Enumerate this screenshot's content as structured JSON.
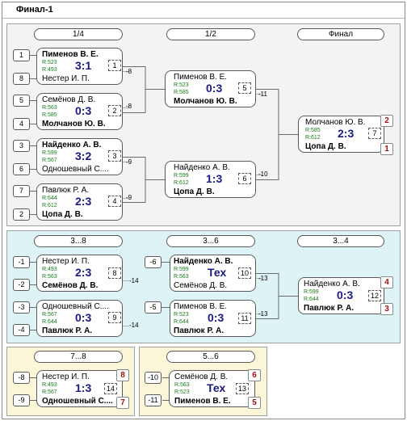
{
  "title": "Финал-1",
  "colors": {
    "score": "#1a1a80",
    "rating": "#1a7a1a",
    "place": "#a01010",
    "main_bg": "#f3f3f3",
    "consolation_bg": "#def3f6",
    "lower_bg": "#fbf6d8"
  },
  "rounds": {
    "quarter": "1/4",
    "semi": "1/2",
    "final": "Финал",
    "r3_8": "3...8",
    "r3_6": "3...6",
    "r3_4": "3...4",
    "r7_8": "7...8",
    "r5_6": "5...6"
  },
  "main": {
    "seeds": [
      "1",
      "8",
      "5",
      "4",
      "3",
      "6",
      "7",
      "2"
    ],
    "qf": [
      {
        "p1": "Пименов В. Е.",
        "r1": "R:523",
        "p2": "Нестер И. П.",
        "r2": "R:493",
        "score": "3:1",
        "num": "1",
        "loser": "-8"
      },
      {
        "p1": "Семёнов Д. В.",
        "r1": "R:563",
        "p2": "Молчанов Ю. В.",
        "r2": "R:585",
        "score": "0:3",
        "num": "2",
        "loser": "-8"
      },
      {
        "p1": "Найденко А. В.",
        "r1": "R:599",
        "p2": "Одношевный С....",
        "r2": "R:567",
        "score": "3:2",
        "num": "3",
        "loser": "-9"
      },
      {
        "p1": "Павлюк Р. А.",
        "r1": "R:644",
        "p2": "Цопа Д. В.",
        "r2": "R:612",
        "score": "2:3",
        "num": "4",
        "loser": "-9"
      }
    ],
    "sf": [
      {
        "p1": "Пименов В. Е.",
        "r1": "R:523",
        "p2": "Молчанов Ю. В.",
        "r2": "R:585",
        "score": "0:3",
        "num": "5",
        "loser": "-11"
      },
      {
        "p1": "Найденко А. В.",
        "r1": "R:599",
        "p2": "Цопа Д. В.",
        "r2": "R:612",
        "score": "1:3",
        "num": "6",
        "loser": "-10"
      }
    ],
    "final": {
      "p1": "Молчанов Ю. В.",
      "r1": "R:585",
      "p2": "Цопа Д. В.",
      "r2": "R:612",
      "score": "2:3",
      "num": "7",
      "place1": "2",
      "place2": "1"
    }
  },
  "consolation": {
    "seeds": [
      "-1",
      "-2",
      "-3",
      "-4"
    ],
    "r38": [
      {
        "p1": "Нестер И. П.",
        "r1": "R:493",
        "p2": "Семёнов Д. В.",
        "r2": "R:563",
        "score": "2:3",
        "num": "8",
        "loser": "-14"
      },
      {
        "p1": "Одношевный С....",
        "r1": "R:567",
        "p2": "Павлюк Р. А.",
        "r2": "R:644",
        "score": "0:3",
        "num": "9",
        "loser": "-14"
      }
    ],
    "r36_seeds": [
      "-6",
      "-5"
    ],
    "r36": [
      {
        "p1": "Найденко А. В.",
        "r1": "R:599",
        "p2": "Семёнов Д. В.",
        "r2": "R:563",
        "score": "Тех",
        "num": "10",
        "loser": "-13"
      },
      {
        "p1": "Пименов В. Е.",
        "r1": "R:523",
        "p2": "Павлюк Р. А.",
        "r2": "R:644",
        "score": "0:3",
        "num": "11",
        "loser": "-13"
      }
    ],
    "r34": {
      "p1": "Найденко А. В.",
      "r1": "R:599",
      "p2": "Павлюк Р. А.",
      "r2": "R:644",
      "score": "0:3",
      "num": "12",
      "place1": "4",
      "place2": "3"
    }
  },
  "lower": {
    "r78": {
      "s1": "-8",
      "s2": "-9",
      "p1": "Нестер И. П.",
      "r1": "R:493",
      "p2": "Одношевный С....",
      "r2": "R:567",
      "score": "1:3",
      "num": "14",
      "place1": "8",
      "place2": "7"
    },
    "r56": {
      "s1": "-10",
      "s2": "-11",
      "p1": "Семёнов Д. В.",
      "r1": "R:563",
      "p2": "Пименов В. Е.",
      "r2": "R:523",
      "score": "Тех",
      "num": "13",
      "place1": "6",
      "place2": "5"
    }
  }
}
